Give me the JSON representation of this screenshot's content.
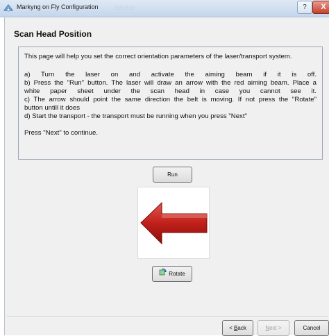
{
  "window": {
    "title": "Markyng on Fly Configuration",
    "ghost_title": "Stecker",
    "help_glyph": "?",
    "close_glyph": "X"
  },
  "page": {
    "heading": "Scan Head Position",
    "intro": "This page will help you set the correct orientation parameters of the laser/transport system.",
    "step_a": "a)  Turn  the  laser  on  and  activate  the  aiming  beam  if  it  is  off.",
    "step_b_1": "b) Press the \"Run\" button. The laser will draw an arrow with the red aiming beam. Place a",
    "step_b_2": "white  paper  sheet  under  the  scan  head  in  case  you  cannot  see  it.",
    "step_c_1": "c) The arrow should point the same direction the belt is moving. If not press the \"Rotate\"",
    "step_c_2": "button untill it does",
    "step_d": "d) Start the transport - the transport must be running when you press \"Next\"",
    "continue": "Press \"Next\" to continue."
  },
  "buttons": {
    "run": "Run",
    "rotate": "Rotate",
    "back_letter": "B",
    "back_rest": "ack",
    "back_prefix": "< ",
    "next_letter": "N",
    "next_rest": "ext >",
    "cancel": "Cancel"
  },
  "colors": {
    "arrow_red": "#c0201a",
    "arrow_dark": "#8e0e0a"
  },
  "icons": {
    "app": "app-logo-icon",
    "rotate": "rotate-icon",
    "arrow": "left-arrow-icon"
  }
}
